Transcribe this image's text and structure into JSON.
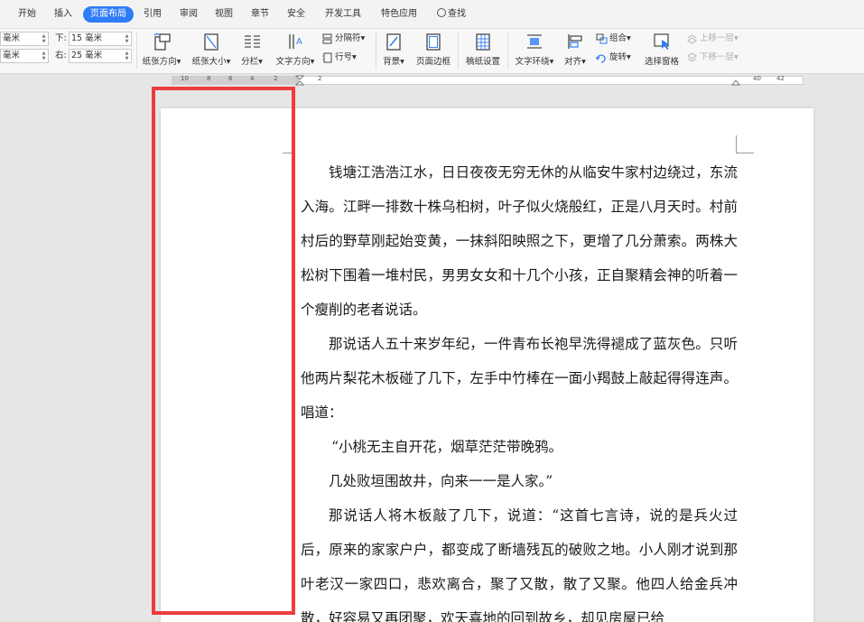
{
  "menubar": {
    "tabs": [
      {
        "label": "开始",
        "active": false
      },
      {
        "label": "插入",
        "active": false
      },
      {
        "label": "页面布局",
        "active": true
      },
      {
        "label": "引用",
        "active": false
      },
      {
        "label": "审阅",
        "active": false
      },
      {
        "label": "视图",
        "active": false
      },
      {
        "label": "章节",
        "active": false
      },
      {
        "label": "安全",
        "active": false
      },
      {
        "label": "开发工具",
        "active": false
      },
      {
        "label": "特色应用",
        "active": false
      }
    ],
    "search_label": "查找"
  },
  "ribbon": {
    "margins": {
      "top_left_value": "毫米",
      "bottom_left_value": "毫米",
      "bottom_label": "下:",
      "bottom_value": "15 毫米",
      "right_label": "右:",
      "right_value": "25 毫米"
    },
    "paper_orientation": "纸张方向",
    "paper_size": "纸张大小",
    "columns": "分栏",
    "text_direction": "文字方向",
    "separator": "分隔符",
    "line_number": "行号",
    "background": "背景",
    "page_border": "页面边框",
    "manuscript": "稿纸设置",
    "text_wrap": "文字环绕",
    "align": "对齐",
    "group": "组合",
    "rotate": "旋转",
    "selection_pane": "选择窗格",
    "bring_forward": "上移一层",
    "send_backward": "下移一层",
    "dropdown_mark": "▾",
    "accent": "#2f7df6"
  },
  "ruler": {
    "numbers": [
      "10",
      "8",
      "6",
      "4",
      "2",
      "2",
      "40",
      "42"
    ]
  },
  "document": {
    "paragraphs": [
      "钱塘江浩浩江水，日日夜夜无穷无休的从临安牛家村边绕过，东流入海。江畔一排数十株乌桕树，叶子似火烧般红，正是八月天时。村前村后的野草刚起始变黄，一抹斜阳映照之下，更增了几分萧索。两株大松树下围着一堆村民，男男女女和十几个小孩，正自聚精会神的听着一个瘦削的老者说话。",
      "那说话人五十来岁年纪，一件青布长袍早洗得褪成了蓝灰色。只听他两片梨花木板碰了几下，左手中竹棒在一面小羯鼓上敲起得得连声。唱道：",
      "“小桃无主自开花，烟草茫茫带晚鸦。",
      "几处败垣围故井，向来一一是人家。”",
      "那说话人将木板敲了几下，说道：“这首七言诗，说的是兵火过后，原来的家家户户，都变成了断墙残瓦的破败之地。小人刚才说到那叶老汉一家四口，悲欢离合，聚了又散，散了又聚。他四人给金兵冲散，好容易又再团聚，欢天喜地的回到故乡，却见房屋已给"
    ]
  },
  "highlight_color": "#ee3b3b"
}
